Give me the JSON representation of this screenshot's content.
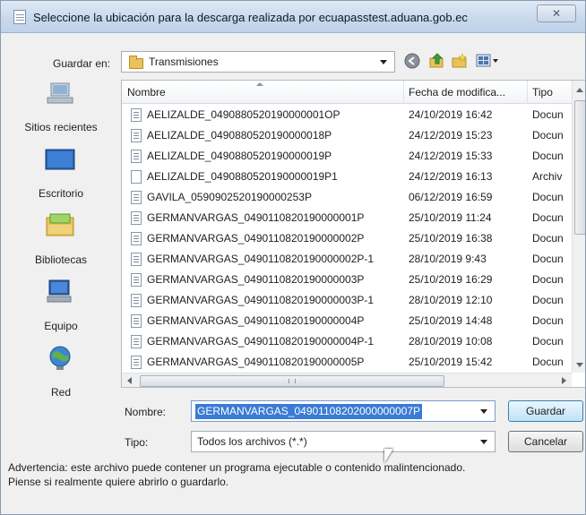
{
  "window": {
    "title": "Seleccione la ubicación para la descarga realizada por ecuapasstest.aduana.gob.ec",
    "close_label": "✕"
  },
  "location": {
    "label": "Guardar en:",
    "folder": "Transmisiones"
  },
  "toolbar": {
    "icons": [
      "back-icon",
      "up-folder-icon",
      "new-folder-icon",
      "views-menu-icon"
    ]
  },
  "places": [
    {
      "label": "Sitios recientes",
      "icon": "recent-places-icon"
    },
    {
      "label": "Escritorio",
      "icon": "desktop-icon"
    },
    {
      "label": "Bibliotecas",
      "icon": "libraries-icon"
    },
    {
      "label": "Equipo",
      "icon": "computer-icon"
    },
    {
      "label": "Red",
      "icon": "network-icon"
    }
  ],
  "columns": {
    "name": "Nombre",
    "date": "Fecha de modifica...",
    "type": "Tipo"
  },
  "files": [
    {
      "name": "AELIZALDE_0490880520190000001OP",
      "date": "24/10/2019 16:42",
      "type": "Docun",
      "icon": "doc"
    },
    {
      "name": "AELIZALDE_0490880520190000018P",
      "date": "24/12/2019 15:23",
      "type": "Docun",
      "icon": "doc"
    },
    {
      "name": "AELIZALDE_0490880520190000019P",
      "date": "24/12/2019 15:33",
      "type": "Docun",
      "icon": "doc"
    },
    {
      "name": "AELIZALDE_0490880520190000019P1",
      "date": "24/12/2019 16:13",
      "type": "Archiv",
      "icon": "blank"
    },
    {
      "name": "GAVILA_0590902520190000253P",
      "date": "06/12/2019 16:59",
      "type": "Docun",
      "icon": "doc"
    },
    {
      "name": "GERMANVARGAS_0490110820190000001P",
      "date": "25/10/2019 11:24",
      "type": "Docun",
      "icon": "doc"
    },
    {
      "name": "GERMANVARGAS_0490110820190000002P",
      "date": "25/10/2019 16:38",
      "type": "Docun",
      "icon": "doc"
    },
    {
      "name": "GERMANVARGAS_0490110820190000002P-1",
      "date": "28/10/2019 9:43",
      "type": "Docun",
      "icon": "doc"
    },
    {
      "name": "GERMANVARGAS_0490110820190000003P",
      "date": "25/10/2019 16:29",
      "type": "Docun",
      "icon": "doc"
    },
    {
      "name": "GERMANVARGAS_0490110820190000003P-1",
      "date": "28/10/2019 12:10",
      "type": "Docun",
      "icon": "doc"
    },
    {
      "name": "GERMANVARGAS_0490110820190000004P",
      "date": "25/10/2019 14:48",
      "type": "Docun",
      "icon": "doc"
    },
    {
      "name": "GERMANVARGAS_0490110820190000004P-1",
      "date": "28/10/2019 10:08",
      "type": "Docun",
      "icon": "doc"
    },
    {
      "name": "GERMANVARGAS_0490110820190000005P",
      "date": "25/10/2019 15:42",
      "type": "Docun",
      "icon": "doc"
    }
  ],
  "form": {
    "name_label": "Nombre:",
    "name_value": "GERMANVARGAS_04901108202000000007P",
    "type_label": "Tipo:",
    "type_value": "Todos los archivos (*.*)"
  },
  "buttons": {
    "save": "Guardar",
    "cancel": "Cancelar"
  },
  "warning": {
    "line1": "Advertencia: este archivo puede contener un programa ejecutable o contenido malintencionado.",
    "line2": "Piense si realmente quiere abrirlo o guardarlo."
  },
  "colors": {
    "selection": "#3a7bd5",
    "titlebar": "#c7d8ec",
    "default_button": "#bfe2f8"
  }
}
